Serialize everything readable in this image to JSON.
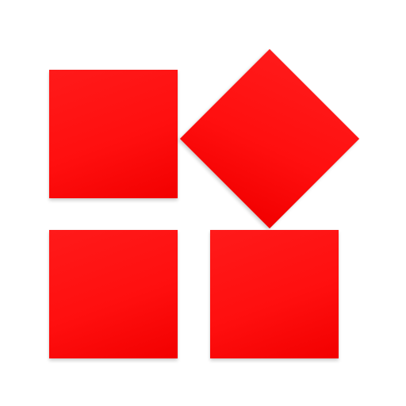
{
  "icon": {
    "name": "app-launcher-tiles-icon",
    "colors": {
      "tile_fill": "#ff0f0f",
      "tile_fill_light": "#ff1a1a",
      "tile_fill_dark": "#f20000",
      "background": "#ffffff"
    },
    "tiles": [
      {
        "name": "tile-top-left",
        "shape": "square"
      },
      {
        "name": "tile-top-right-diamond",
        "shape": "diamond"
      },
      {
        "name": "tile-bottom-left",
        "shape": "square"
      },
      {
        "name": "tile-bottom-right",
        "shape": "square"
      }
    ]
  }
}
